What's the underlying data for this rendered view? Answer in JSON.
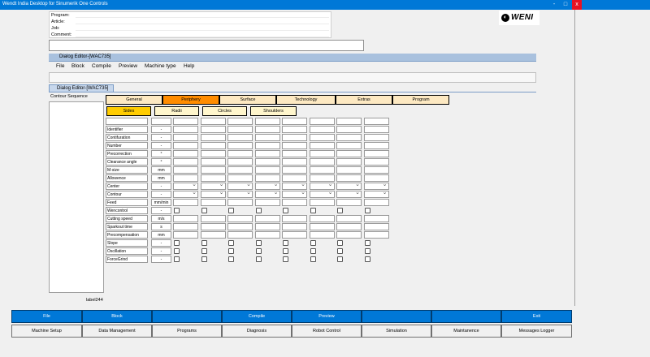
{
  "window": {
    "title": "Wendt India Desktop for Sinumerik One Controls",
    "minimize": "-",
    "maximize": "□",
    "close": "x"
  },
  "info": {
    "program": "Program:",
    "article": "Article:",
    "job": "Job:",
    "comment": "Comment:"
  },
  "logo": {
    "text": "WENI",
    "icon": "wendt-logo-icon"
  },
  "dialog_editor": {
    "title": "Dialog Editor-[WAC735]",
    "tab_title": "Dialog Editor-[WAC735]"
  },
  "menu": [
    "File",
    "Block",
    "Compile",
    "Preview",
    "Machine type",
    "Help"
  ],
  "contour": {
    "title": "Contour Sequence",
    "footer_label": "label244"
  },
  "tabs_top": [
    "General",
    "Periphery",
    "Surface",
    "Technology",
    "Extras",
    "Program"
  ],
  "tabs_top_active": "Periphery",
  "tabs_sub": [
    "Sides",
    "Radii",
    "Circles",
    "Shoulders"
  ],
  "tabs_sub_active": "Sides",
  "params": [
    {
      "label": "Identifier",
      "unit": "-",
      "kind": "text"
    },
    {
      "label": "Contifuration",
      "unit": "-",
      "kind": "text"
    },
    {
      "label": "Number",
      "unit": "-",
      "kind": "text"
    },
    {
      "label": "Precorrection",
      "unit": "°",
      "kind": "text"
    },
    {
      "label": "Clearance angle",
      "unit": "°",
      "kind": "text"
    },
    {
      "label": "M-size",
      "unit": "mm",
      "kind": "text"
    },
    {
      "label": "Allowence",
      "unit": "mm",
      "kind": "text"
    },
    {
      "label": "Center",
      "unit": "-",
      "kind": "dropdown"
    },
    {
      "label": "Contour",
      "unit": "-",
      "kind": "dropdown"
    },
    {
      "label": "Feed",
      "unit": "mm/min",
      "kind": "text"
    },
    {
      "label": "Wencontrol",
      "unit": "-",
      "kind": "checkbox"
    },
    {
      "label": "Cutting speed",
      "unit": "m/s",
      "kind": "text"
    },
    {
      "label": "Sparkout time",
      "unit": "s",
      "kind": "text"
    },
    {
      "label": "Precompensation",
      "unit": "mm",
      "kind": "text"
    },
    {
      "label": "Slope",
      "unit": "-",
      "kind": "checkbox"
    },
    {
      "label": "Oscillation",
      "unit": "-",
      "kind": "checkbox"
    },
    {
      "label": "ForceGrind",
      "unit": "-",
      "kind": "checkbox"
    }
  ],
  "function_buttons": [
    "File",
    "Block",
    "",
    "Compile",
    "Preview",
    "",
    "",
    "Exit"
  ],
  "nav_buttons": [
    "Machine Setup",
    "Data Management",
    "Programs",
    "Diagnosis",
    "Robot Control",
    "Simulation",
    "Maintanence",
    "Messages Logger"
  ],
  "colors": {
    "accent": "#0078d7",
    "tab_active": "#ff8c00",
    "subtab_active": "#ffcc00",
    "close": "#e81123"
  }
}
